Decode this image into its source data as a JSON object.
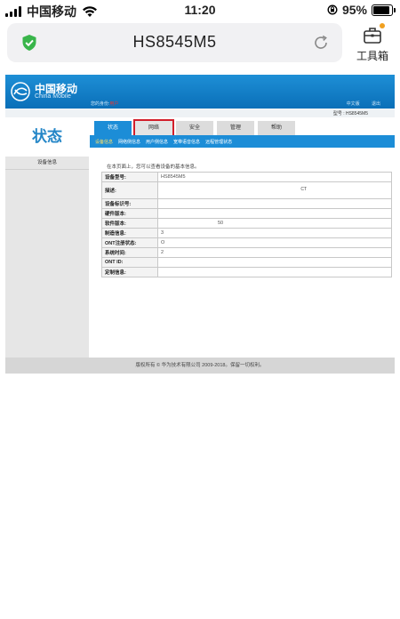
{
  "status_bar": {
    "carrier": "中国移动",
    "time": "11:20",
    "battery": "95%"
  },
  "browser": {
    "url_title": "HS8545M5",
    "toolbox_label": "工具箱"
  },
  "router": {
    "logo_cn": "中国移动",
    "logo_en": "China Mobile",
    "login_prefix": "您的身份:",
    "login_user": "用户",
    "right_link_1": "中文版",
    "right_link_2": "退出",
    "model_label": "型号 : HS8545M5",
    "left_title": "状态",
    "left_items": [
      "设备信息"
    ],
    "tabs": [
      "状态",
      "网络",
      "安全",
      "管理",
      "帮助"
    ],
    "subnav": [
      "设备信息",
      "网络侧信息",
      "用户侧信息",
      "宽带语音信息",
      "远程管理状态"
    ],
    "intro": "在本页面上，您可以查看设备的基本信息。",
    "table_rows": [
      {
        "label": "设备型号:",
        "value": "HS8545M5"
      },
      {
        "label": "描述:",
        "value": "",
        "extra": "CT"
      },
      {
        "label": "设备标识号:",
        "value": ""
      },
      {
        "label": "硬件版本:",
        "value": ""
      },
      {
        "label": "软件版本:",
        "value": "50"
      },
      {
        "label": "制造信息:",
        "value": "3"
      },
      {
        "label": "ONT注册状态:",
        "value": "O"
      },
      {
        "label": "系统时间:",
        "value": "2"
      },
      {
        "label": "ONT ID:",
        "value": ""
      },
      {
        "label": "定制信息:",
        "value": ""
      }
    ],
    "footer": "版权所有 © 华为技术有限公司 2009-2018。保留一切权利。"
  }
}
